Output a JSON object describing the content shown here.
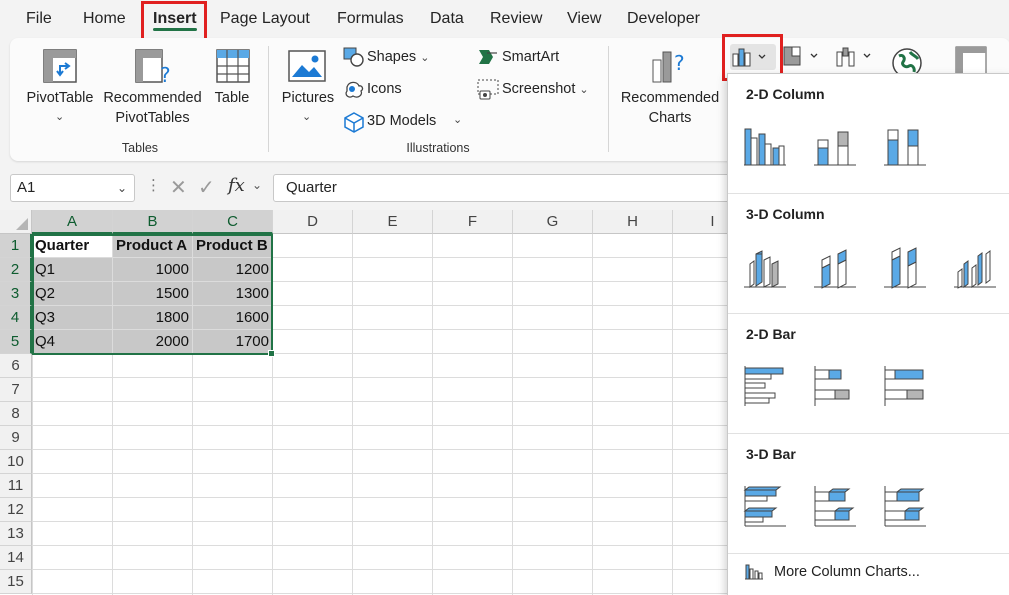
{
  "tabs": [
    "File",
    "Home",
    "Insert",
    "Page Layout",
    "Formulas",
    "Data",
    "Review",
    "View",
    "Developer"
  ],
  "active_tab": "Insert",
  "ribbon": {
    "pivot_table": "PivotTable",
    "recommended_pivot": "Recommended",
    "recommended_pivot2": "PivotTables",
    "table": "Table",
    "tables_group": "Tables",
    "pictures": "Pictures",
    "shapes": "Shapes",
    "icons": "Icons",
    "models_3d": "3D Models",
    "smartart": "SmartArt",
    "screenshot": "Screenshot",
    "illustrations_group": "Illustrations",
    "recommended_charts": "Recommended",
    "recommended_charts2": "Charts"
  },
  "formula_bar": {
    "name_box": "A1",
    "fx": "fx",
    "content": "Quarter"
  },
  "grid": {
    "columns": [
      "A",
      "B",
      "C",
      "D",
      "E",
      "F",
      "G",
      "H",
      "I"
    ],
    "rows": [
      "1",
      "2",
      "3",
      "4",
      "5",
      "6",
      "7",
      "8",
      "9",
      "10",
      "11",
      "12",
      "13",
      "14",
      "15"
    ],
    "header": [
      "Quarter",
      "Product A",
      "Product B"
    ],
    "data": [
      [
        "Q1",
        "1000",
        "1200"
      ],
      [
        "Q2",
        "1500",
        "1300"
      ],
      [
        "Q3",
        "1800",
        "1600"
      ],
      [
        "Q4",
        "2000",
        "1700"
      ]
    ]
  },
  "dropdown": {
    "sections": [
      "2-D Column",
      "3-D Column",
      "2-D Bar",
      "3-D Bar"
    ],
    "more": "More Column Charts..."
  },
  "colors": {
    "excel_green": "#217346",
    "highlight_red": "#e0201f",
    "chart_blue": "#5aa9e6"
  }
}
